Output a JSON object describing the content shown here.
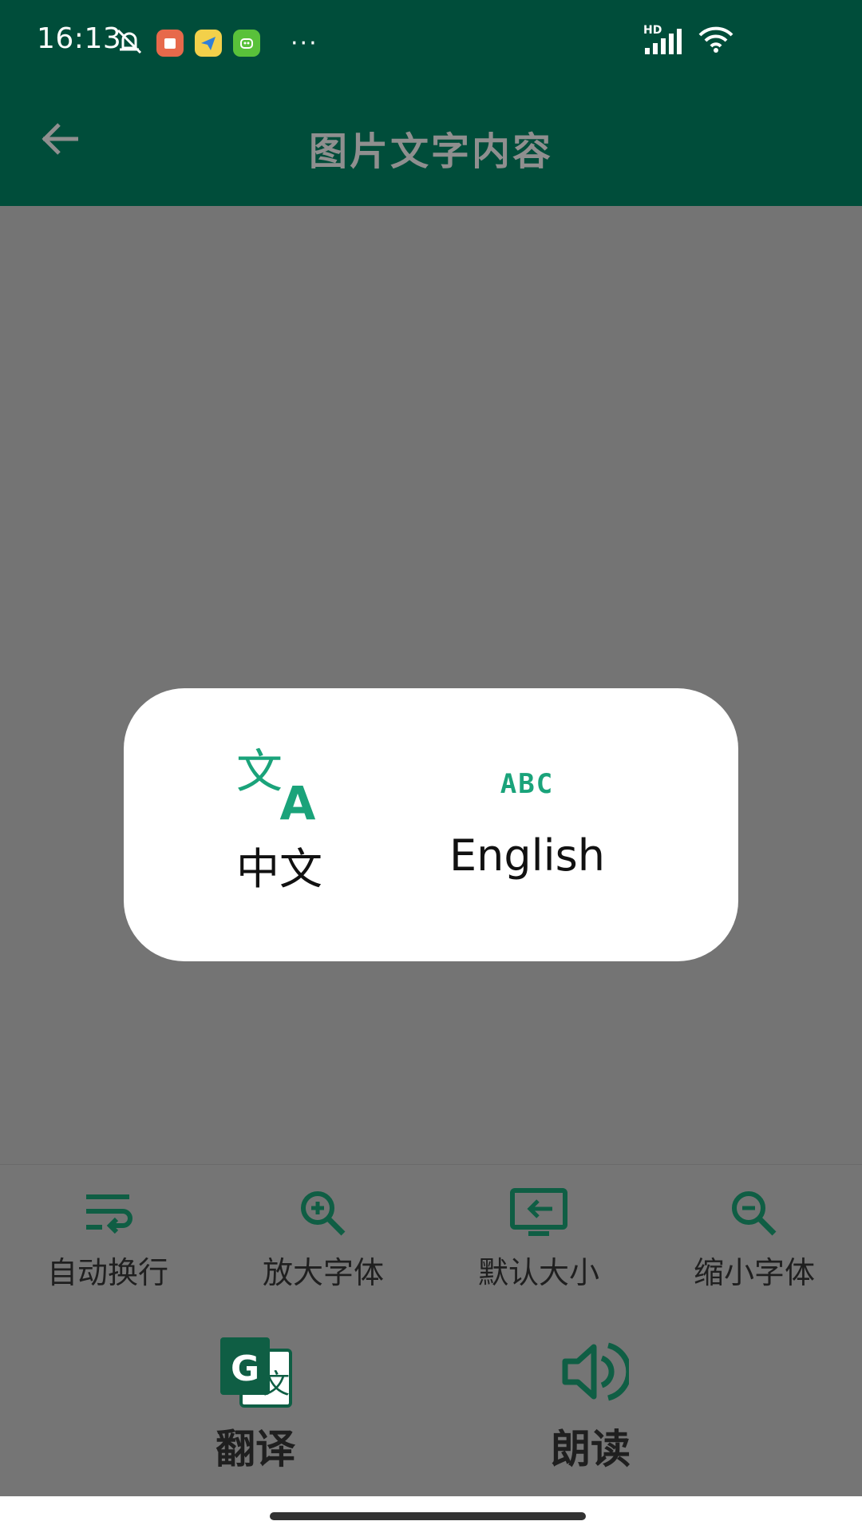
{
  "status_bar": {
    "time": "16:13",
    "more": "···",
    "signal_label": "HD"
  },
  "app_bar": {
    "title": "图片文字内容"
  },
  "toolbar": {
    "tools": [
      {
        "label": "自动换行",
        "icon": "wrap-text-icon"
      },
      {
        "label": "放大字体",
        "icon": "zoom-in-icon"
      },
      {
        "label": "默认大小",
        "icon": "default-size-icon"
      },
      {
        "label": "缩小字体",
        "icon": "zoom-out-icon"
      }
    ],
    "actions": [
      {
        "label": "翻译",
        "icon": "translate-icon"
      },
      {
        "label": "朗读",
        "icon": "speaker-icon"
      }
    ]
  },
  "dialog": {
    "options": [
      {
        "label": "中文",
        "icon": "chinese-translate-icon"
      },
      {
        "label": "English",
        "icon": "abc-icon",
        "icon_text": "ABC"
      }
    ]
  },
  "colors": {
    "brand": "#004d3a",
    "accent": "#1aa37a",
    "icon_dark": "#0f5e44",
    "overlay_bg": "#747474"
  }
}
